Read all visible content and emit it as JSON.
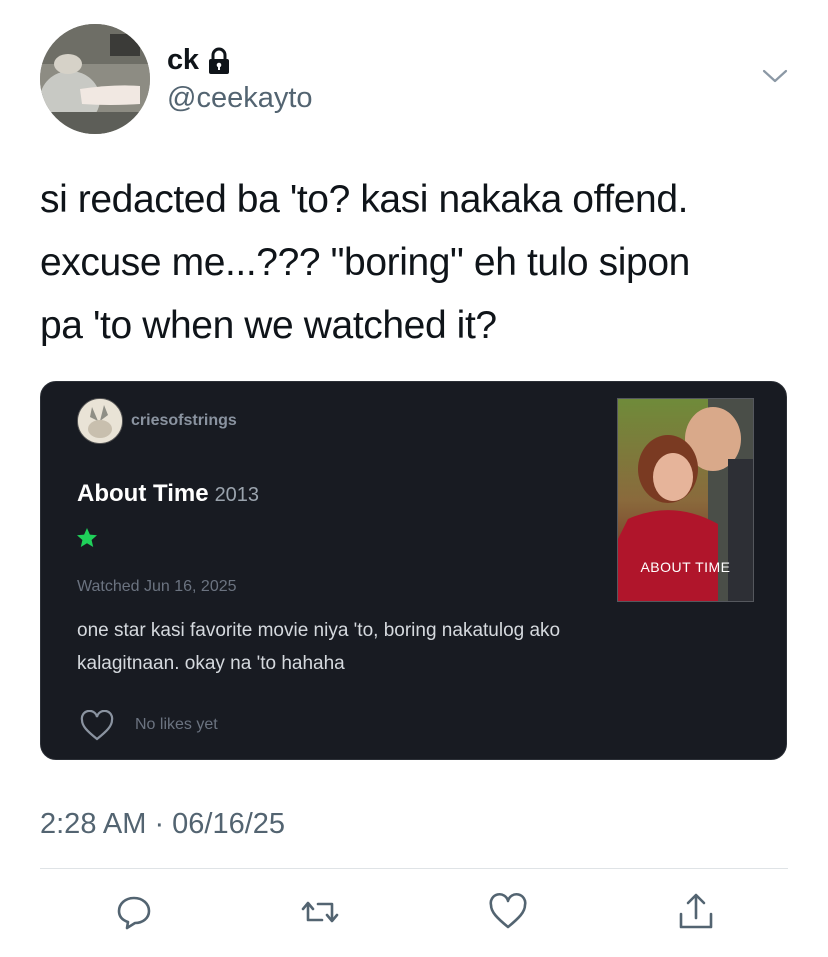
{
  "tweet": {
    "author_name": "ck",
    "author_handle": "@ceekayto",
    "protected_icon": "lock-icon",
    "text_lines": [
      "si redacted ba 'to? kasi nakaka offend.",
      "excuse me...??? \"boring\" eh tulo sipon",
      "pa 'to when we watched it?"
    ],
    "timestamp": "2:28 AM · 06/16/25"
  },
  "embedded_review": {
    "username": "criesofstrings",
    "movie_title": "About Time",
    "movie_year": "2013",
    "rating_stars": 1,
    "watched": "Watched Jun 16, 2025",
    "review_lines": [
      "one star kasi favorite movie niya 'to, boring nakatulog ako",
      "kalagitnaan. okay na 'to hahaha"
    ],
    "likes_text": "No likes yet",
    "poster_title": "ABOUT TIME",
    "star_color": "#1fd15a"
  },
  "actions": [
    "reply-icon",
    "retweet-icon",
    "like-icon",
    "share-icon"
  ],
  "colors": {
    "text_primary": "#0f1419",
    "text_secondary": "#536471",
    "card_bg": "#181b22"
  }
}
